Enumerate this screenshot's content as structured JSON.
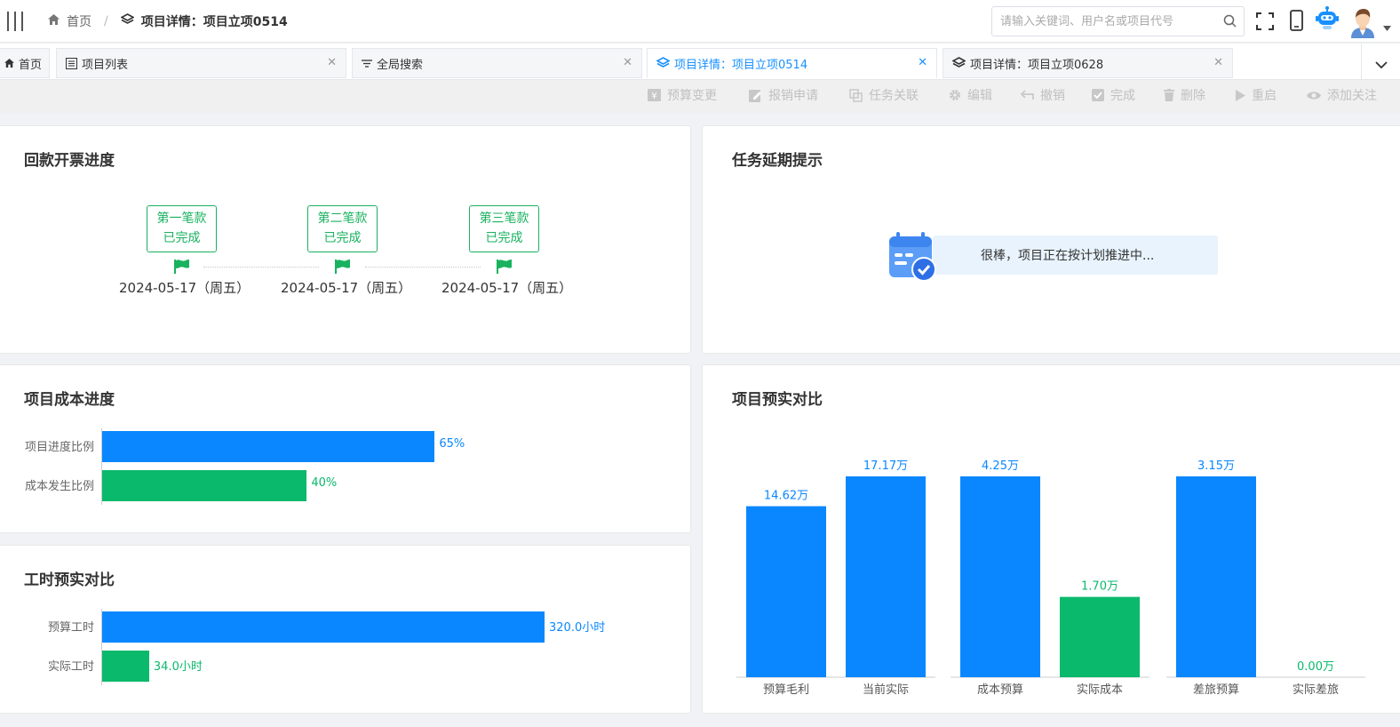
{
  "header": {
    "home_label": "首页",
    "current_title": "项目详情：项目立项0514",
    "search_placeholder": "请输入关键词、用户名或项目代号"
  },
  "tabs": [
    {
      "label": "首页"
    },
    {
      "label": "项目列表"
    },
    {
      "label": "全局搜索"
    },
    {
      "label": "项目详情：项目立项0514",
      "active": true
    },
    {
      "label": "项目详情：项目立项0628"
    }
  ],
  "toolbar": [
    "预算变更",
    "报销申请",
    "任务关联",
    "编辑",
    "撤销",
    "完成",
    "删除",
    "重启",
    "添加关注"
  ],
  "payment": {
    "title": "回款开票进度",
    "milestones": [
      {
        "name": "第一笔款",
        "status": "已完成",
        "date": "2024-05-17（周五）"
      },
      {
        "name": "第二笔款",
        "status": "已完成",
        "date": "2024-05-17（周五）"
      },
      {
        "name": "第三笔款",
        "status": "已完成",
        "date": "2024-05-17（周五）"
      }
    ]
  },
  "delay": {
    "title": "任务延期提示",
    "message": "很棒，项目正在按计划推进中..."
  },
  "cost_progress": {
    "title": "项目成本进度",
    "rows": [
      {
        "label": "项目进度比例",
        "percent": 65,
        "display": "65%",
        "color": "#0a87ff"
      },
      {
        "label": "成本发生比例",
        "percent": 40,
        "display": "40%",
        "color": "#0ab96b"
      }
    ]
  },
  "hours": {
    "title": "工时预实对比",
    "rows": [
      {
        "label": "预算工时",
        "value": 320.0,
        "display": "320.0小时",
        "color": "#0a87ff"
      },
      {
        "label": "实际工时",
        "value": 34.0,
        "display": "34.0小时",
        "color": "#0ab96b"
      }
    ]
  },
  "budget_actual": {
    "title": "项目预实对比"
  },
  "chart_data": {
    "type": "bar",
    "categories": [
      "预算毛利",
      "当前实际",
      "成本预算",
      "实际成本",
      "差旅预算",
      "实际差旅"
    ],
    "values": [
      14.62,
      17.17,
      4.25,
      1.7,
      3.15,
      0.0
    ],
    "value_labels": [
      "14.62万",
      "17.17万",
      "4.25万",
      "1.70万",
      "3.15万",
      "0.00万"
    ],
    "colors": [
      "#0a87ff",
      "#0a87ff",
      "#0a87ff",
      "#0ab96b",
      "#0a87ff",
      "#0ab96b"
    ],
    "note": "each pair (budget / actual) drawn on its own scale",
    "grid": false
  }
}
